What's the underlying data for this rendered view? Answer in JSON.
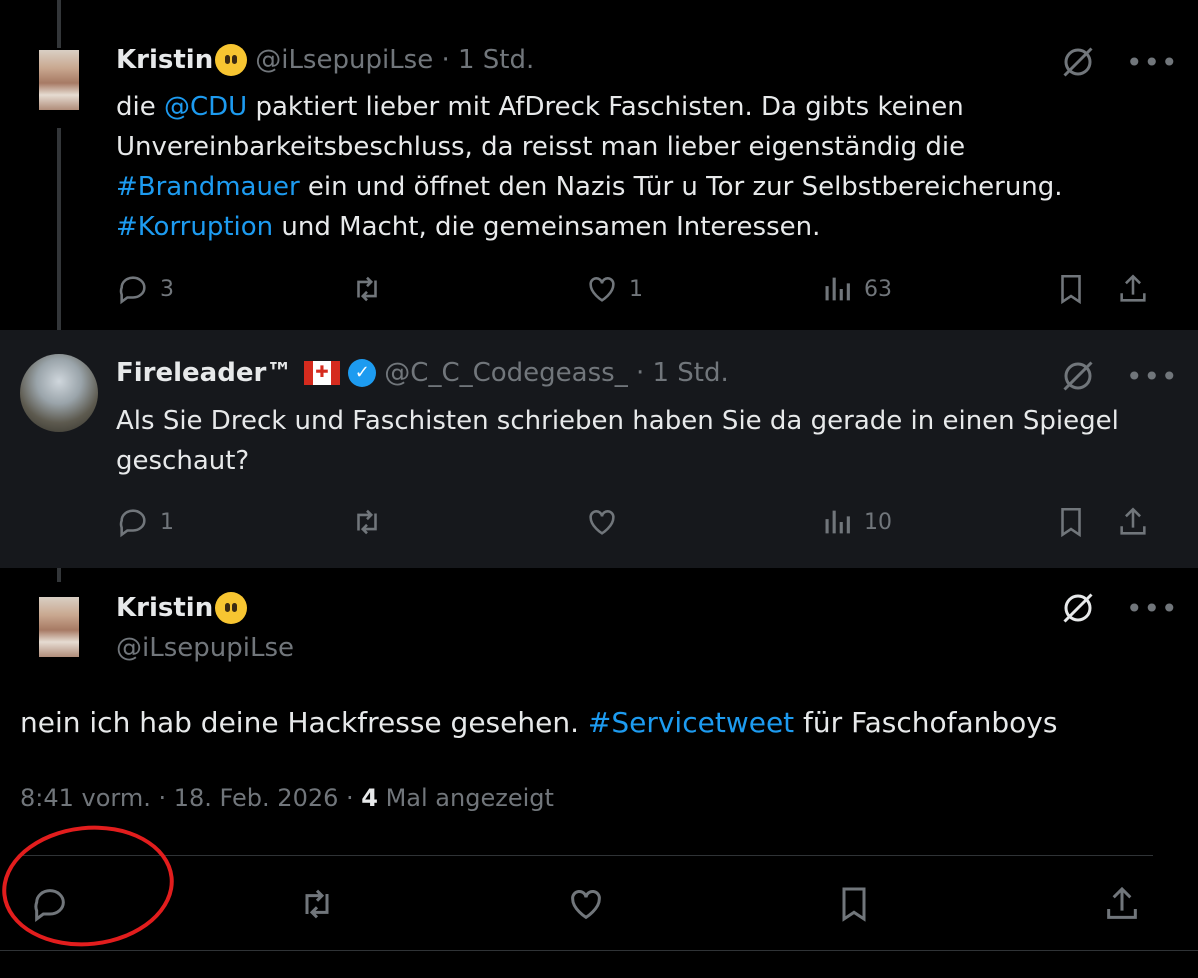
{
  "tweet1": {
    "name": "Kristin",
    "handle": "@iLsepupiLse · 1 Std.",
    "text_parts": [
      "die ",
      "@CDU",
      " paktiert lieber mit AfDreck Faschisten. Da gibts keinen Unvereinbarkeitsbeschluss, da reisst man lieber eigenständig die ",
      "#Brandmauer",
      " ein und öffnet den Nazis Tür u Tor zur Selbstbereicherung. ",
      "#Korruption",
      " und Macht, die gemeinsamen Interessen."
    ],
    "replies": "3",
    "likes": "1",
    "views": "63"
  },
  "tweet2": {
    "name": "Fireleader™",
    "handle": "@C_C_Codegeass_ · 1 Std.",
    "text": "Als Sie Dreck und Faschisten schrieben haben Sie da gerade in einen Spiegel geschaut?",
    "replies": "1",
    "views": "10"
  },
  "main": {
    "name": "Kristin",
    "handle": "@iLsepupiLse",
    "text_before": "nein ich hab deine Hackfresse gesehen. ",
    "hashtag": "#Servicetweet",
    "text_after": " für Faschofanboys",
    "time": "8:41 vorm. · 18. Feb. 2026 · ",
    "views_count": "4",
    "views_label": " Mal angezeigt"
  },
  "colors": {
    "link": "#1d9bf0",
    "annotation": "#e21d1d"
  }
}
